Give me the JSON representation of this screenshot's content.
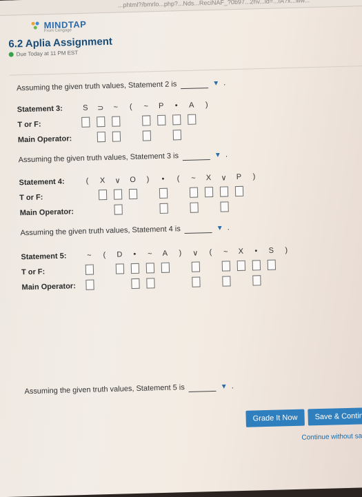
{
  "browser": {
    "url": "...phtml?/bmrlo...php?...Nds...ReciNAF_?0b97...2hv...ld=...fA?x...ww..."
  },
  "app": {
    "logo": "MINDTAP",
    "logo_sub": "From Cengage"
  },
  "assignment": {
    "title": "6.2 Aplia Assignment",
    "due": "Due Today at 11 PM EST"
  },
  "prompts": {
    "s2": "Assuming the given truth values, Statement 2 is",
    "s3": "Assuming the given truth values, Statement 3 is",
    "s4": "Assuming the given truth values, Statement 4 is",
    "s5": "Assuming the given truth values, Statement 5 is"
  },
  "row_labels": {
    "tf": "T or F:",
    "main_op": "Main Operator:"
  },
  "statement3": {
    "label": "Statement 3:",
    "symbols": [
      "S",
      "⊃",
      "~",
      "(",
      "~",
      "P",
      "•",
      "A",
      ")"
    ]
  },
  "statement4": {
    "label": "Statement 4:",
    "symbols": [
      "(",
      "X",
      "∨",
      "O",
      ")",
      "•",
      "(",
      "~",
      "X",
      "∨",
      "P",
      ")"
    ]
  },
  "statement5": {
    "label": "Statement 5:",
    "symbols": [
      "~",
      "(",
      "D",
      "•",
      "~",
      "A",
      ")",
      "∨",
      "(",
      "~",
      "X",
      "•",
      "S",
      ")"
    ]
  },
  "buttons": {
    "grade": "Grade It Now",
    "save": "Save & Continue",
    "continue": "Continue without saving"
  },
  "icons": {
    "dropdown": "caret-down-icon",
    "due": "status-dot-icon"
  }
}
